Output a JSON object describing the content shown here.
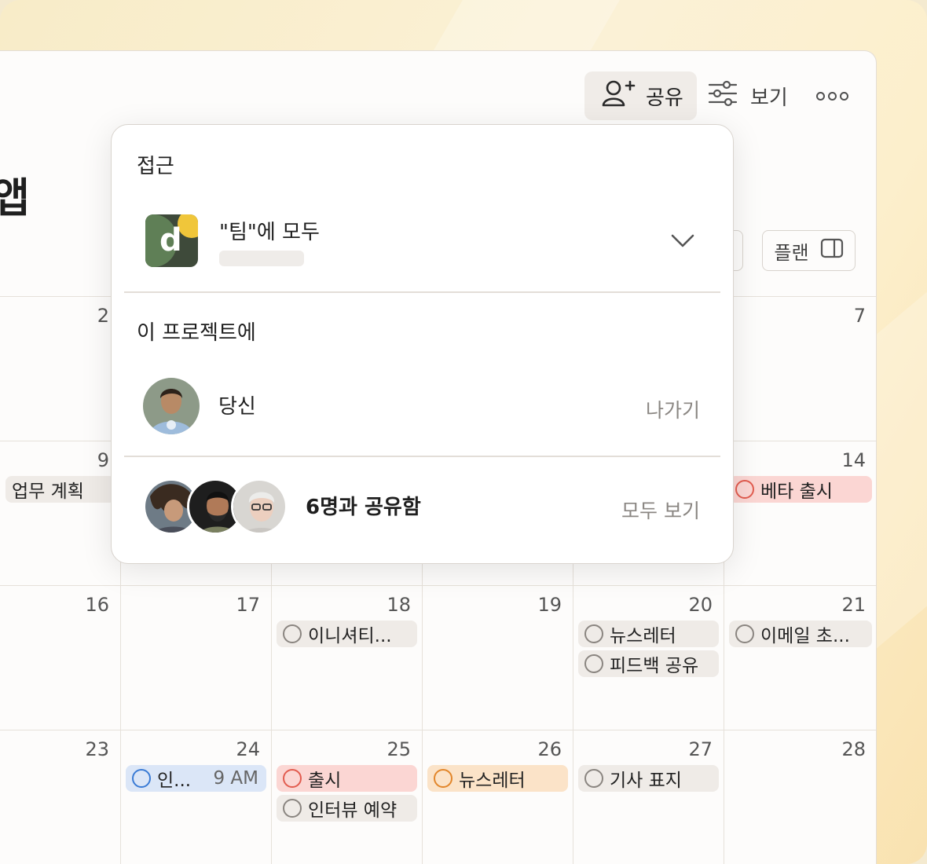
{
  "toolbar": {
    "share_label": "공유",
    "view_label": "보기",
    "plan_label": "플랜"
  },
  "page_title_fragment": "앱",
  "calendar": {
    "rows": [
      {
        "days": [
          {
            "num": "2",
            "events": []
          },
          {
            "num": "",
            "events": []
          },
          {
            "num": "",
            "events": []
          },
          {
            "num": "",
            "events": []
          },
          {
            "num": "",
            "events": []
          },
          {
            "num": "7",
            "events": []
          }
        ]
      },
      {
        "days": [
          {
            "num": "9",
            "events": [
              {
                "label": "업무 계획",
                "color": "gray",
                "nocircle": true
              }
            ]
          },
          {
            "num": "",
            "events": []
          },
          {
            "num": "",
            "events": []
          },
          {
            "num": "",
            "events": []
          },
          {
            "num": "",
            "events": []
          },
          {
            "num": "14",
            "events": [
              {
                "label": "베타 출시",
                "color": "red"
              }
            ]
          }
        ]
      },
      {
        "days": [
          {
            "num": "16",
            "events": []
          },
          {
            "num": "17",
            "events": []
          },
          {
            "num": "18",
            "events": [
              {
                "label": "이니셔티...",
                "color": "gray"
              }
            ]
          },
          {
            "num": "19",
            "events": []
          },
          {
            "num": "20",
            "events": [
              {
                "label": "뉴스레터",
                "color": "gray"
              },
              {
                "label": "피드백 공유",
                "color": "gray"
              }
            ]
          },
          {
            "num": "21",
            "events": [
              {
                "label": "이메일 초...",
                "color": "gray"
              }
            ]
          }
        ]
      },
      {
        "days": [
          {
            "num": "23",
            "events": []
          },
          {
            "num": "24",
            "events": [
              {
                "label": "인...",
                "time": "9 AM",
                "color": "blue"
              }
            ]
          },
          {
            "num": "25",
            "events": [
              {
                "label": "출시",
                "color": "red"
              },
              {
                "label": "인터뷰 예약",
                "color": "gray"
              }
            ]
          },
          {
            "num": "26",
            "events": [
              {
                "label": "뉴스레터",
                "color": "orange"
              }
            ]
          },
          {
            "num": "27",
            "events": [
              {
                "label": "기사 표지",
                "color": "gray"
              }
            ]
          },
          {
            "num": "28",
            "events": []
          }
        ]
      }
    ]
  },
  "popover": {
    "access_heading": "접근",
    "team_label": "\"팀\"에 모두",
    "project_heading": "이 프로젝트에",
    "you_label": "당신",
    "leave_label": "나가기",
    "shared_label": "6명과 공유함",
    "view_all_label": "모두 보기"
  },
  "colors": {
    "accent_red": "#e25c4f",
    "accent_orange": "#e2862a",
    "accent_blue": "#3a7bd5"
  }
}
